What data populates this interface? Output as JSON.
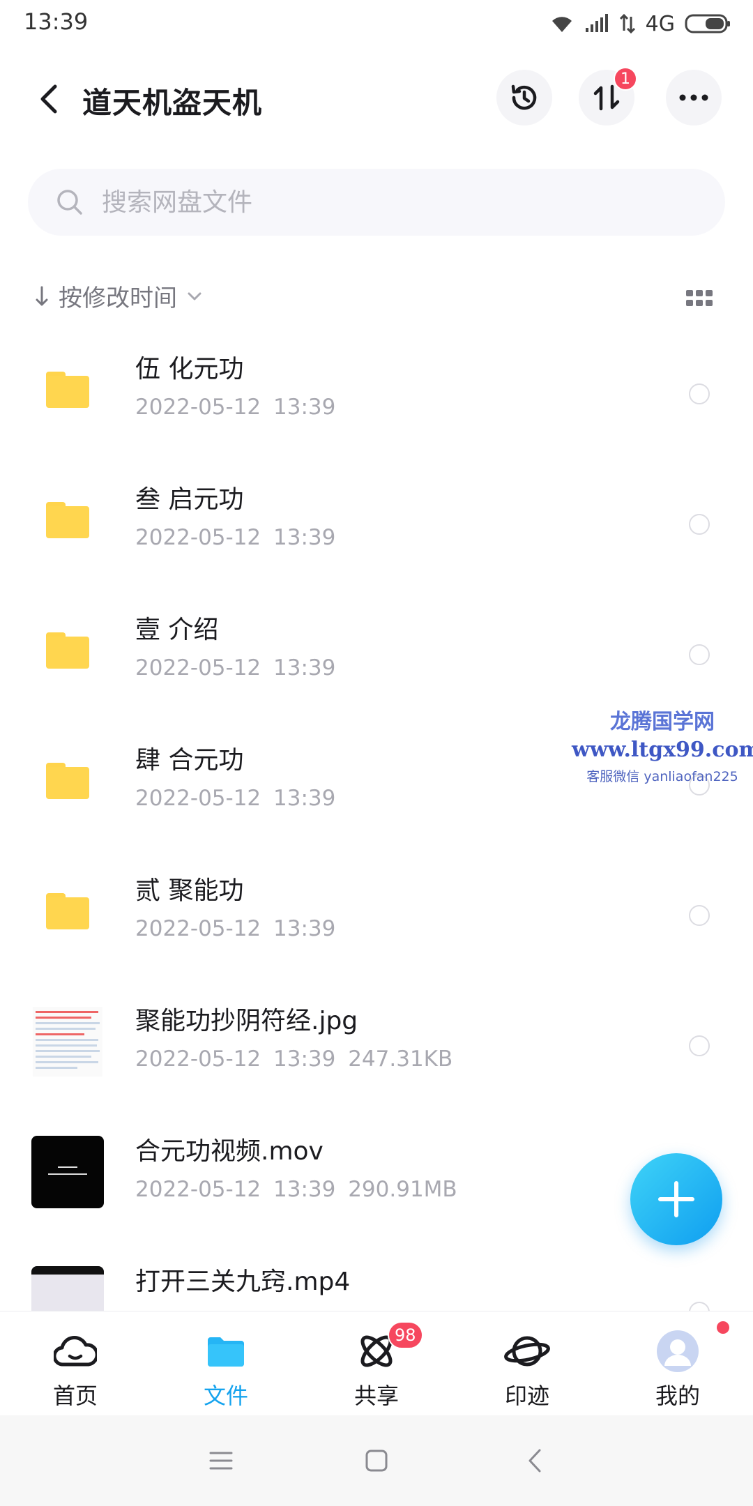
{
  "status_bar": {
    "time": "13:39",
    "network": "4G"
  },
  "header": {
    "title": "道天机盗天机",
    "transfer_badge": "1"
  },
  "search": {
    "placeholder": "搜索网盘文件"
  },
  "sort": {
    "label": "按修改时间"
  },
  "files": [
    {
      "name": "伍 化元功",
      "meta": "2022-05-12  13:39",
      "type": "folder"
    },
    {
      "name": "叁 启元功",
      "meta": "2022-05-12  13:39",
      "type": "folder"
    },
    {
      "name": "壹 介绍",
      "meta": "2022-05-12  13:39",
      "type": "folder"
    },
    {
      "name": "肆 合元功",
      "meta": "2022-05-12  13:39",
      "type": "folder"
    },
    {
      "name": "贰 聚能功",
      "meta": "2022-05-12  13:39",
      "type": "folder"
    },
    {
      "name": "聚能功抄阴符经.jpg",
      "meta": "2022-05-12  13:39  247.31KB",
      "type": "image"
    },
    {
      "name": "合元功视频.mov",
      "meta": "2022-05-12  13:39  290.91MB",
      "type": "video"
    },
    {
      "name": "打开三关九窍.mp4",
      "meta": "",
      "type": "video"
    }
  ],
  "watermark": {
    "line1": "龙腾国学网",
    "line2": "www.ltgx99.com",
    "line3": "客服微信 yanliaofan225"
  },
  "nav": {
    "items": [
      {
        "label": "首页",
        "icon": "cloud-home-icon"
      },
      {
        "label": "文件",
        "icon": "folder-icon",
        "active": true
      },
      {
        "label": "共享",
        "icon": "atom-share-icon",
        "badge": "98"
      },
      {
        "label": "印迹",
        "icon": "planet-icon"
      },
      {
        "label": "我的",
        "icon": "avatar-icon"
      }
    ]
  },
  "colors": {
    "accent": "#15a3ee",
    "badge": "#f6475e",
    "folder": "#ffd64f"
  }
}
